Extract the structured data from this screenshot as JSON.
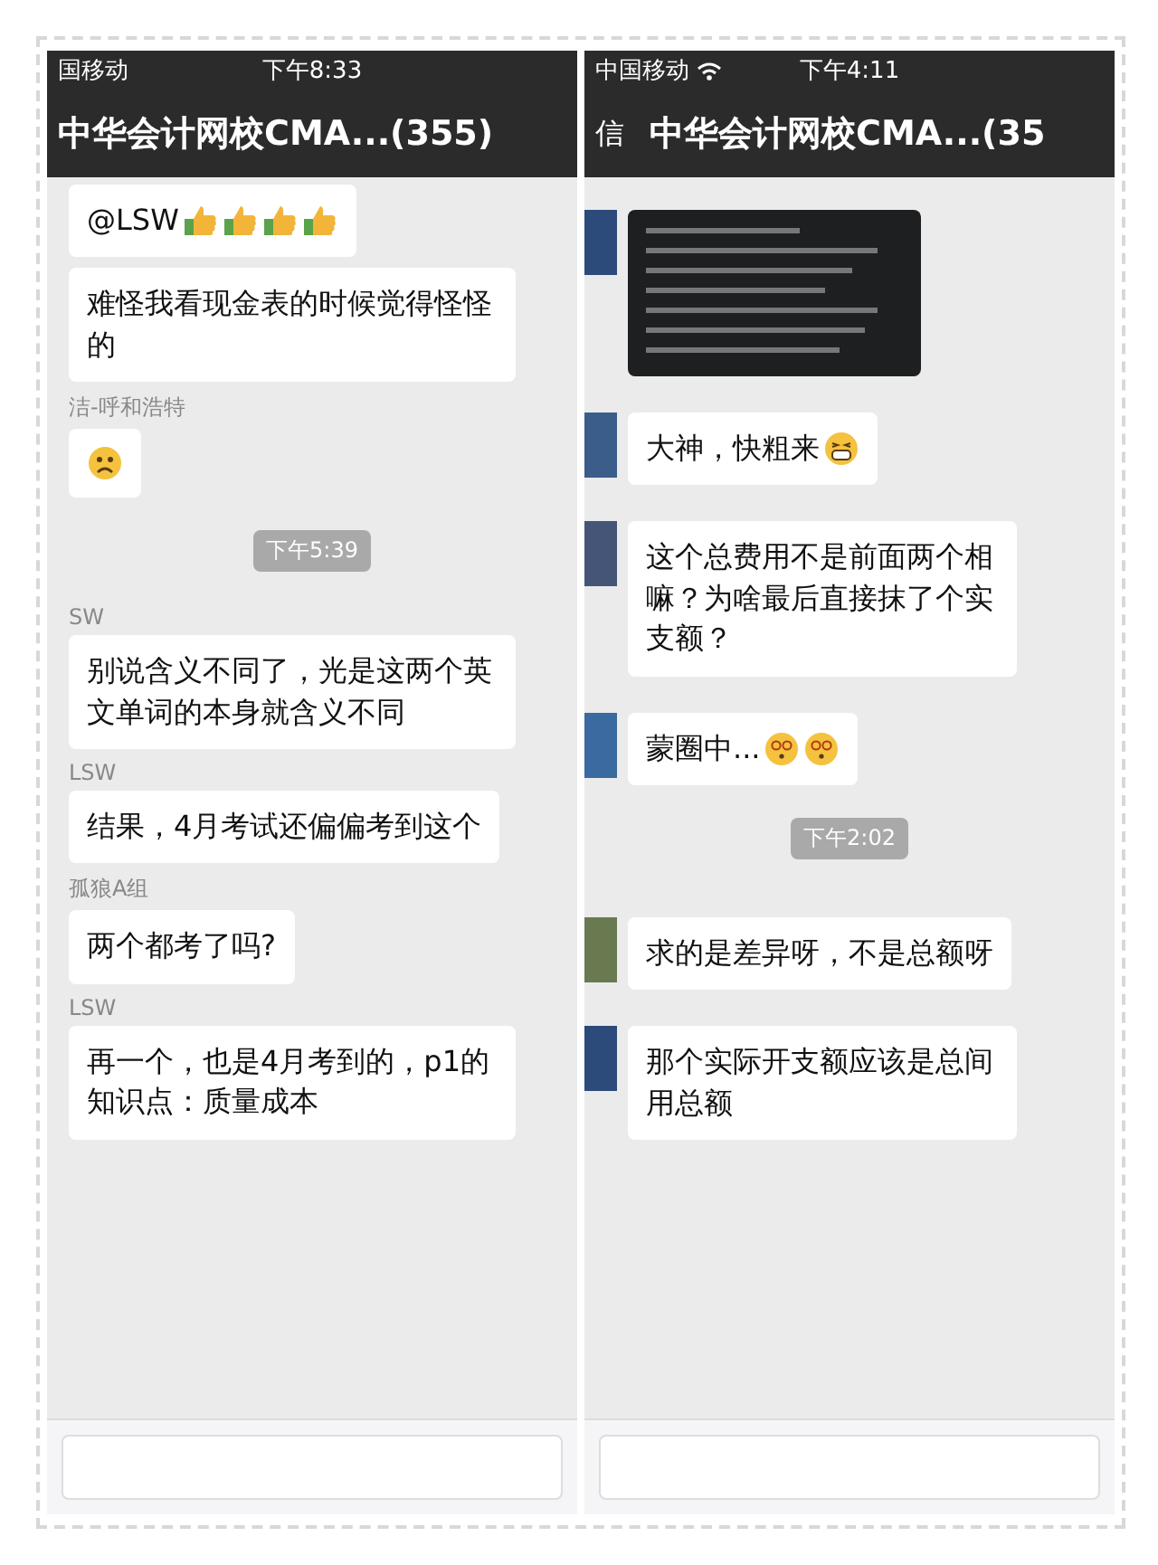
{
  "panels": [
    {
      "status_bar": {
        "carrier": "国移动",
        "time": "下午8:33"
      },
      "title_bar": {
        "title": "中华会计网校CMA...(355)"
      },
      "messages": [
        {
          "kind": "text",
          "text": "@LSW",
          "emoji": [
            {
              "kind": "thumbs_up"
            },
            {
              "kind": "thumbs_up"
            },
            {
              "kind": "thumbs_up"
            },
            {
              "kind": "thumbs_up"
            }
          ]
        },
        {
          "kind": "text",
          "text": "难怪我看现金表的时候觉得怪怪的"
        },
        {
          "kind": "text",
          "sender": "洁-呼和浩特",
          "emoji": [
            {
              "kind": "worried"
            }
          ]
        },
        {
          "kind": "time",
          "text": "下午5:39"
        },
        {
          "kind": "text",
          "sender": "SW",
          "text": "别说含义不同了，光是这两个英文单词的本身就含义不同"
        },
        {
          "kind": "text",
          "sender": "LSW",
          "text": "结果，4月考试还偏偏考到这个"
        },
        {
          "kind": "text",
          "sender": "孤狼A组",
          "text": "两个都考了吗?"
        },
        {
          "kind": "text",
          "sender": "LSW",
          "text": "再一个，也是4月考到的，p1的知识点：质量成本"
        }
      ]
    },
    {
      "status_bar": {
        "carrier": "中国移动",
        "wifi": true,
        "time": "下午4:11"
      },
      "title_bar": {
        "back": "信",
        "title": "中华会计网校CMA...(35"
      },
      "messages": [
        {
          "kind": "image",
          "avatar": true
        },
        {
          "kind": "text",
          "avatar": true,
          "text": "大神，快粗来",
          "emoji": [
            {
              "kind": "grin"
            }
          ]
        },
        {
          "kind": "text",
          "avatar": true,
          "text": "这个总费用不是前面两个相嘛？为啥最后直接抹了个实支额？"
        },
        {
          "kind": "text",
          "avatar": true,
          "text": "蒙圈中...",
          "emoji": [
            {
              "kind": "dizzy"
            },
            {
              "kind": "dizzy"
            }
          ]
        },
        {
          "kind": "time",
          "text": "下午2:02"
        },
        {
          "kind": "text",
          "avatar": true,
          "text": "求的是差异呀，不是总额呀"
        },
        {
          "kind": "text",
          "avatar": true,
          "text": "那个实际开支额应该是总间用总额"
        }
      ]
    }
  ]
}
